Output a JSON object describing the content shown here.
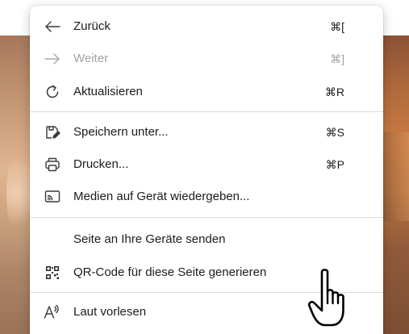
{
  "menu": {
    "items": [
      {
        "label": "Zurück",
        "shortcut": "⌘[",
        "icon": "arrow-left-icon",
        "enabled": true
      },
      {
        "label": "Weiter",
        "shortcut": "⌘]",
        "icon": "arrow-right-icon",
        "enabled": false
      },
      {
        "label": "Aktualisieren",
        "shortcut": "⌘R",
        "icon": "refresh-icon",
        "enabled": true
      },
      {
        "label": "Speichern unter...",
        "shortcut": "⌘S",
        "icon": "save-as-icon",
        "enabled": true
      },
      {
        "label": "Drucken...",
        "shortcut": "⌘P",
        "icon": "print-icon",
        "enabled": true
      },
      {
        "label": "Medien auf Gerät wiedergeben...",
        "shortcut": "",
        "icon": "cast-icon",
        "enabled": true
      },
      {
        "label": "Seite an Ihre Geräte senden",
        "shortcut": "",
        "icon": "",
        "enabled": true
      },
      {
        "label": "QR-Code für diese Seite generieren",
        "shortcut": "",
        "icon": "qr-code-icon",
        "enabled": true
      },
      {
        "label": "Laut vorlesen",
        "shortcut": "",
        "icon": "read-aloud-icon",
        "enabled": true
      }
    ]
  },
  "colors": {
    "text": "#1c1c1c",
    "disabled_text": "#a3a3a3",
    "divider": "#dcdcdc",
    "menu_background": "#ffffff"
  },
  "cursor": {
    "icon": "hand-pointer-icon"
  }
}
